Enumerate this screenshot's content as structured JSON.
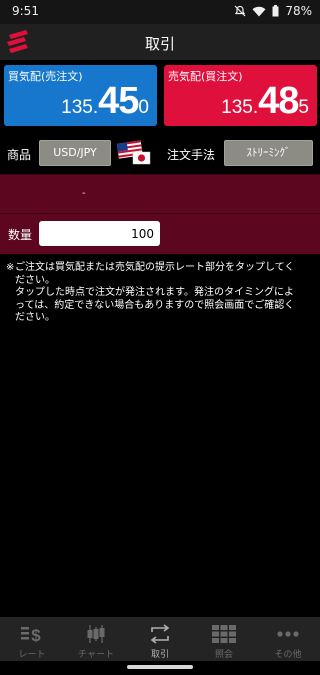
{
  "status_bar": {
    "time": "9:51",
    "battery": "78%"
  },
  "header": {
    "title": "取引"
  },
  "bid": {
    "label": "買気配(売注文)",
    "price_small": "135.",
    "price_big": "45",
    "price_last": "0"
  },
  "ask": {
    "label": "売気配(買注文)",
    "price_small": "135.",
    "price_big": "48",
    "price_last": "5"
  },
  "product": {
    "label": "商品",
    "value": "USD/JPY"
  },
  "order_method": {
    "label": "注文手法",
    "value": "ｽﾄﾘｰﾐﾝｸﾞ"
  },
  "info_dash": "-",
  "quantity": {
    "label": "数量",
    "value": "100"
  },
  "notice": {
    "mark": "※",
    "lines": [
      "ご注文は買気配または売気配の提示レート部分をタップしてく",
      "ださい。",
      "タップした時点で注文が発注されます。発注のタイミングによ",
      "っては、約定できない場合もありますので照会画面でご確認く",
      "ださい。"
    ]
  },
  "nav": [
    {
      "label": "レート",
      "icon": "rate-icon"
    },
    {
      "label": "チャート",
      "icon": "chart-icon"
    },
    {
      "label": "取引",
      "icon": "trade-icon"
    },
    {
      "label": "照会",
      "icon": "inquiry-icon"
    },
    {
      "label": "その他",
      "icon": "more-icon"
    }
  ],
  "colors": {
    "bid": "#1677cc",
    "ask": "#e0103c",
    "info_band": "#5c0620",
    "active_nav": "#b0b0b0"
  }
}
